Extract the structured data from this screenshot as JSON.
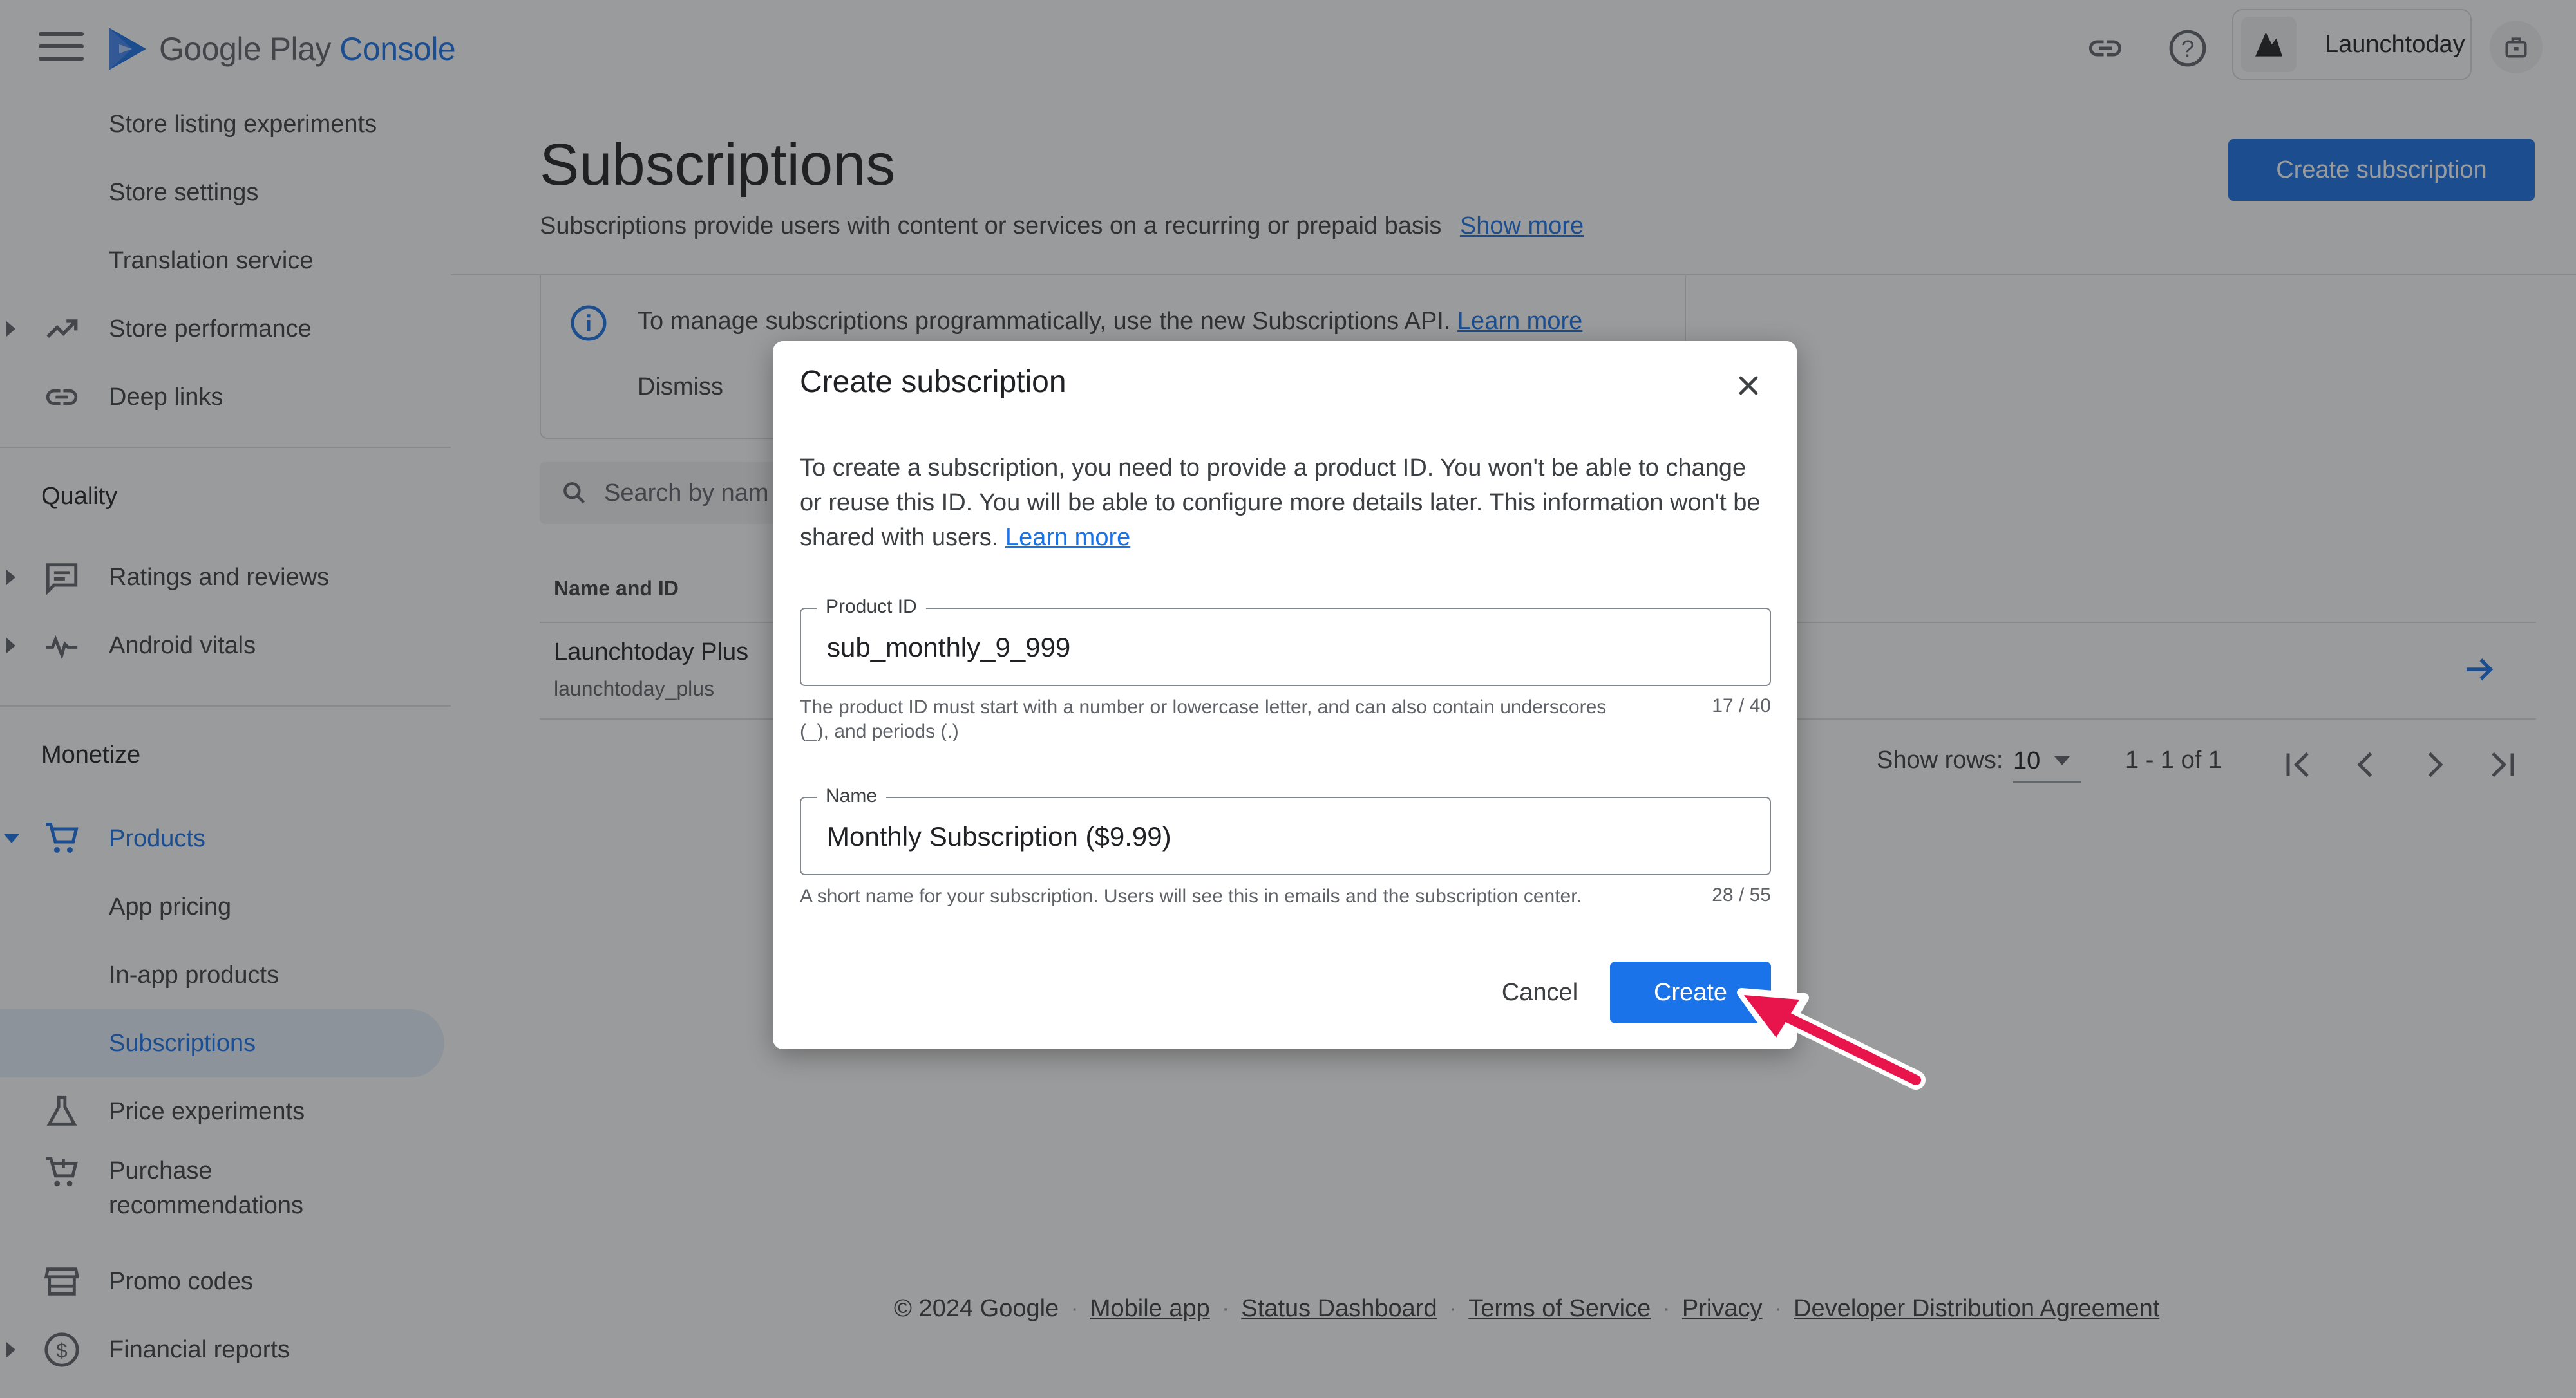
{
  "app": {
    "logo_text_main": "Google Play",
    "logo_text_accent": "Console",
    "account_name": "Launchtoday",
    "icons": [
      "menu-icon",
      "play-console-logo",
      "link-icon",
      "help-icon",
      "account-avatar",
      "notifications-icon"
    ]
  },
  "sidebar": {
    "top_items": [
      {
        "label": "Store listing experiments"
      },
      {
        "label": "Store settings"
      },
      {
        "label": "Translation service"
      },
      {
        "label": "Store performance",
        "icon": "trending-up-icon"
      },
      {
        "label": "Deep links",
        "icon": "link-icon"
      }
    ],
    "quality": {
      "title": "Quality",
      "items": [
        {
          "label": "Ratings and reviews",
          "icon": "reviews-icon"
        },
        {
          "label": "Android vitals",
          "icon": "vitals-icon"
        }
      ]
    },
    "monetize": {
      "title": "Monetize",
      "products": {
        "label": "Products",
        "icon": "cart-icon"
      },
      "sub_items": [
        {
          "label": "App pricing"
        },
        {
          "label": "In-app products"
        },
        {
          "label": "Subscriptions"
        }
      ],
      "items": [
        {
          "label": "Price experiments",
          "icon": "flask-icon"
        },
        {
          "label": "Purchase recommendations",
          "icon": "cart-add-icon"
        },
        {
          "label": "Promo codes",
          "icon": "store-icon"
        },
        {
          "label": "Financial reports",
          "icon": "dollar-icon"
        }
      ]
    }
  },
  "main": {
    "title": "Subscriptions",
    "subtitle": "Subscriptions provide users with content or services on a recurring or prepaid basis",
    "show_more": "Show more",
    "create_button": "Create subscription",
    "banner": {
      "text": "To manage subscriptions programmatically, use the new Subscriptions API.",
      "learn_more": "Learn more",
      "dismiss": "Dismiss"
    },
    "search_placeholder": "Search by nam",
    "table": {
      "column_header": "Name and ID",
      "rows": [
        {
          "name": "Launchtoday Plus",
          "id": "launchtoday_plus"
        }
      ]
    },
    "pagination": {
      "show_rows_label": "Show rows:",
      "rows_value": "10",
      "range": "1 - 1 of 1"
    }
  },
  "footer": {
    "copyright": "© 2024 Google",
    "links": [
      "Mobile app",
      "Status Dashboard",
      "Terms of Service",
      "Privacy",
      "Developer Distribution Agreement"
    ]
  },
  "dialog": {
    "title": "Create subscription",
    "description": "To create a subscription, you need to provide a product ID. You won't be able to change or reuse this ID. You will be able to configure more details later. This information won't be shared with users.",
    "learn_more": "Learn more",
    "product_id": {
      "label": "Product ID",
      "value": "sub_monthly_9_999",
      "helper": "The product ID must start with a number or lowercase letter, and can also contain underscores (_), and periods (.)",
      "counter": "17 / 40"
    },
    "name": {
      "label": "Name",
      "value": "Monthly Subscription ($9.99)",
      "helper": "A short name for your subscription. Users will see this in emails and the subscription center.",
      "counter": "28 / 55"
    },
    "cancel": "Cancel",
    "create": "Create"
  },
  "colors": {
    "accent": "#1a73e8",
    "annotation_arrow": "#e8144c",
    "scrim": "rgba(32,33,36,0.45)"
  }
}
